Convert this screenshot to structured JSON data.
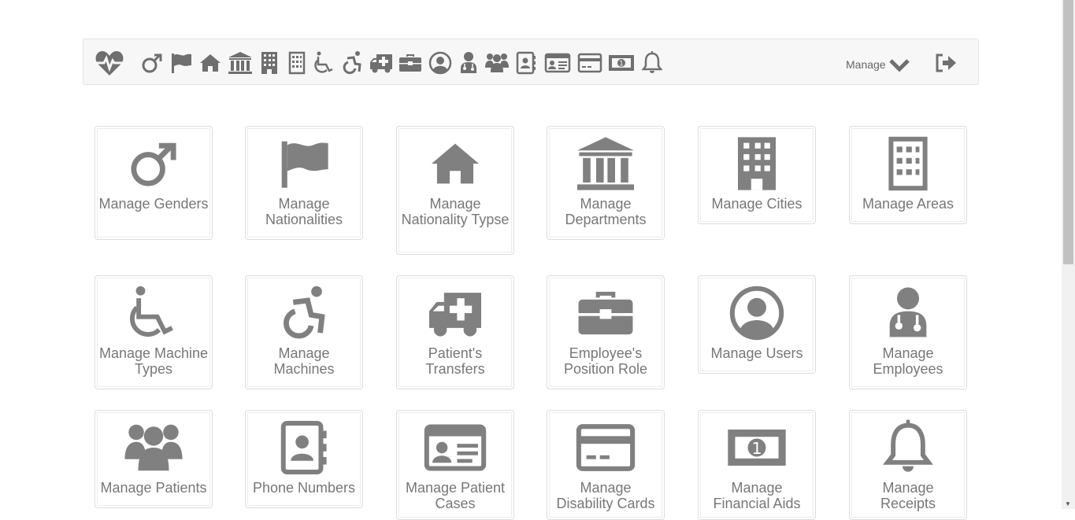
{
  "navbar": {
    "manage_label": "Manage",
    "icons": [
      "heartbeat-logo-icon",
      "male-icon",
      "flag-icon",
      "home-icon",
      "bank-icon",
      "building-icon",
      "building-outline-icon",
      "wheelchair-icon",
      "wheelchair-active-icon",
      "ambulance-icon",
      "briefcase-icon",
      "user-circle-icon",
      "doctor-icon",
      "users-icon",
      "address-book-icon",
      "id-card-icon",
      "credit-card-icon",
      "money-bill-icon",
      "bell-icon",
      "logout-icon"
    ]
  },
  "tiles": [
    {
      "label": "Manage Genders",
      "icon": "male-icon"
    },
    {
      "label": "Manage Nationalities",
      "icon": "flag-icon"
    },
    {
      "label": "Manage Nationality Typse",
      "icon": "home-icon"
    },
    {
      "label": "Manage Departments",
      "icon": "bank-icon"
    },
    {
      "label": "Manage Cities",
      "icon": "building-icon"
    },
    {
      "label": "Manage Areas",
      "icon": "building-outline-icon"
    },
    {
      "label": "Manage Machine Types",
      "icon": "wheelchair-icon"
    },
    {
      "label": "Manage Machines",
      "icon": "wheelchair-active-icon"
    },
    {
      "label": "Patient's Transfers",
      "icon": "ambulance-icon"
    },
    {
      "label": "Employee's Position Role",
      "icon": "briefcase-icon"
    },
    {
      "label": "Manage Users",
      "icon": "user-circle-icon"
    },
    {
      "label": "Manage Employees",
      "icon": "doctor-icon"
    },
    {
      "label": "Manage Patients",
      "icon": "users-icon"
    },
    {
      "label": "Phone Numbers",
      "icon": "address-book-icon"
    },
    {
      "label": "Manage Patient Cases",
      "icon": "id-card-icon"
    },
    {
      "label": "Manage Disability Cards",
      "icon": "credit-card-icon"
    },
    {
      "label": "Manage Financial Aids",
      "icon": "money-bill-icon"
    },
    {
      "label": "Manage Receipts",
      "icon": "bell-icon"
    }
  ]
}
